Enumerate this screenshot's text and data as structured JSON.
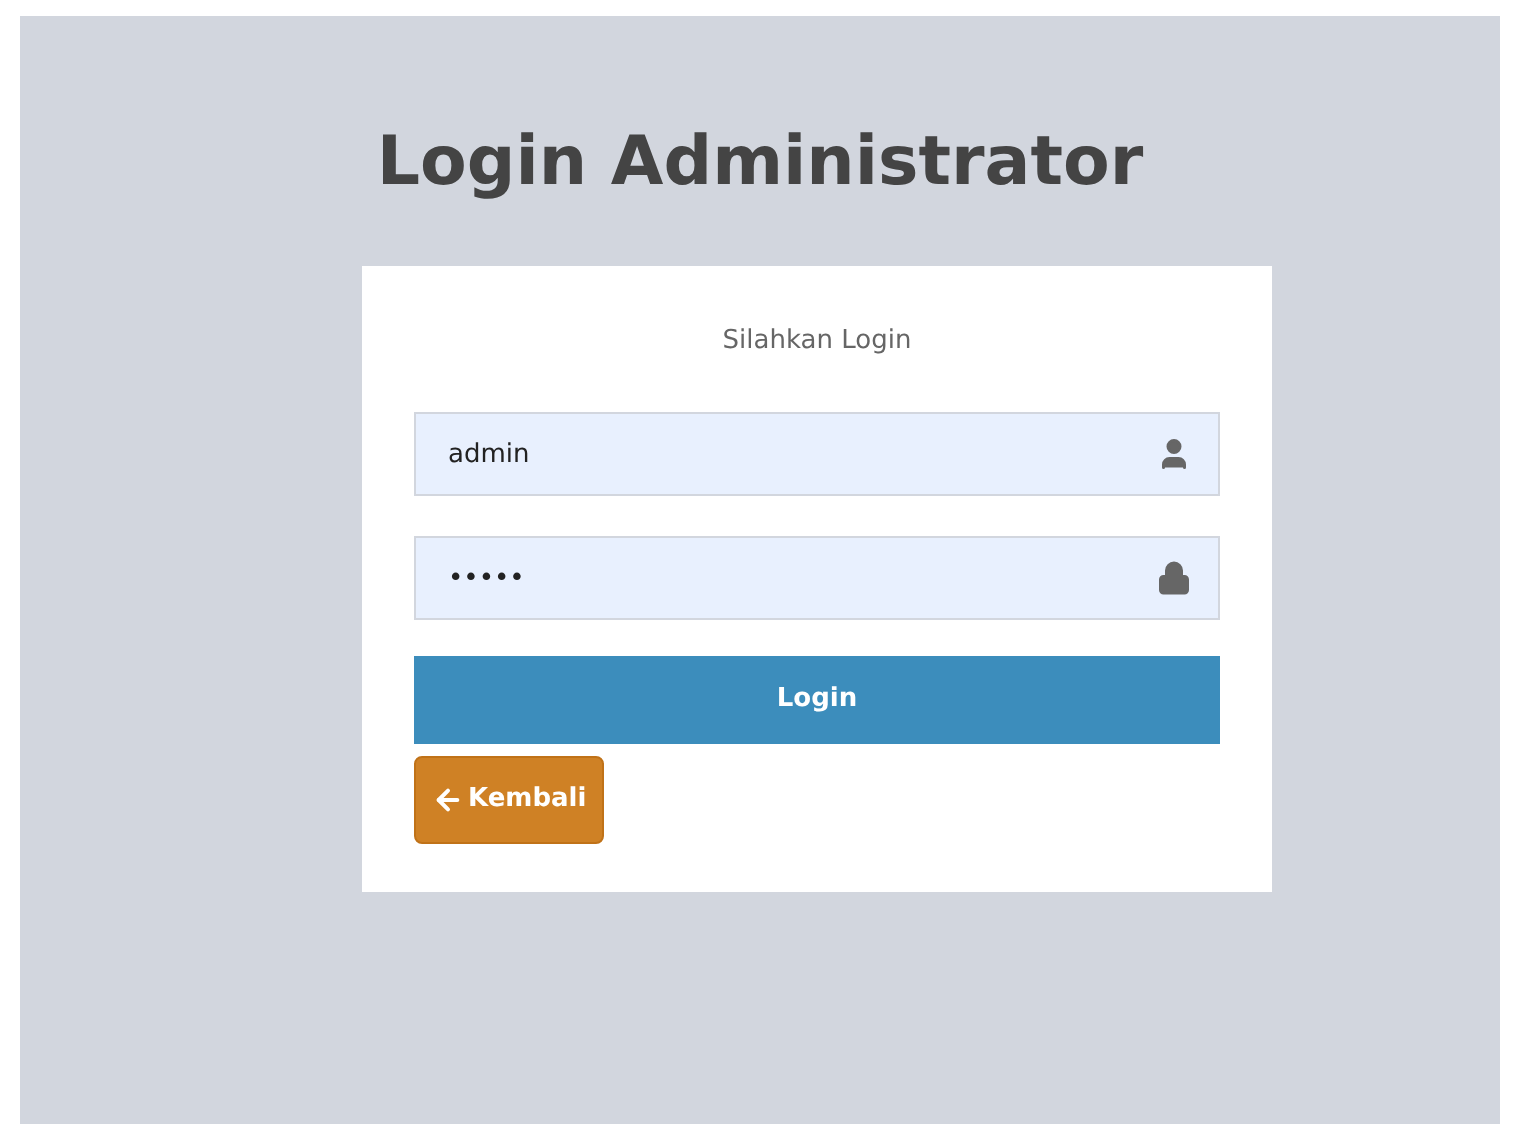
{
  "title": "Login Administrator",
  "card": {
    "heading": "Silahkan Login",
    "fields": [
      {
        "kind": "user",
        "value": "admin"
      },
      {
        "kind": "password",
        "value": "•••••"
      }
    ],
    "login_button": "Login",
    "back_button": {
      "label": "Kembali"
    }
  }
}
